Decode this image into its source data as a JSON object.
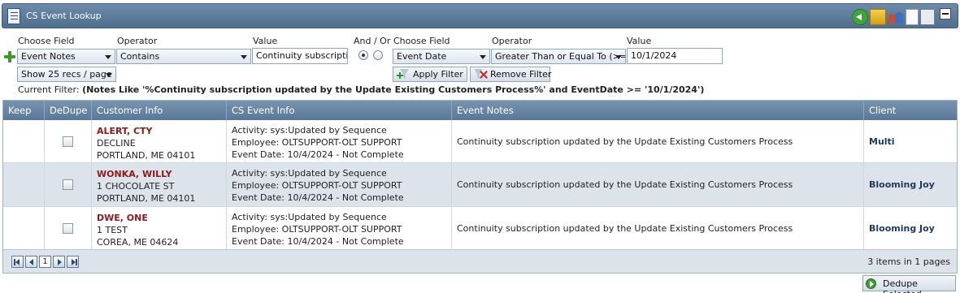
{
  "window": {
    "title": "CS Event Lookup",
    "toolbar_icons": [
      "back-icon",
      "box-icon",
      "users-icon",
      "document-icon",
      "files-icon",
      "minimize-icon"
    ]
  },
  "filter": {
    "left": {
      "choose_field_label": "Choose Field",
      "operator_label": "Operator",
      "value_label": "Value",
      "field": "Event Notes",
      "operator": "Contains",
      "value": "Continuity subscription"
    },
    "and_or_label": "And / Or",
    "and_or_selected": "And",
    "right": {
      "choose_field_label": "Choose Field",
      "operator_label": "Operator",
      "value_label": "Value",
      "field": "Event Date",
      "operator": "Greater Than or Equal To (>=)",
      "value": "10/1/2024"
    },
    "page_size": "Show 25 recs / page",
    "apply_label": "Apply Filter",
    "remove_label": "Remove Filter",
    "current_filter_label": "Current Filter:",
    "current_filter_value": "(Notes Like '%Continuity subscription updated by the Update Existing Customers Process%' and EventDate >= '10/1/2024')"
  },
  "grid": {
    "columns": [
      "Keep",
      "DeDupe",
      "Customer Info",
      "CS Event Info",
      "Event Notes",
      "Client"
    ],
    "rows": [
      {
        "name": "ALERT, CTY",
        "address1": "DECLINE",
        "address2": "PORTLAND, ME 04101",
        "activity": "Activity: sys:Updated by Sequence",
        "employee": "Employee: OLTSUPPORT-OLT SUPPORT",
        "event_date": "Event Date: 10/4/2024  - Not Complete",
        "notes": "Continuity subscription updated by the Update Existing Customers Process",
        "client": "Multi"
      },
      {
        "name": "WONKA, WILLY",
        "address1": "1 CHOCOLATE ST",
        "address2": "PORTLAND, ME 04101",
        "activity": "Activity: sys:Updated by Sequence",
        "employee": "Employee: OLTSUPPORT-OLT SUPPORT",
        "event_date": "Event Date: 10/4/2024  - Not Complete",
        "notes": "Continuity subscription updated by the Update Existing Customers Process",
        "client": "Blooming Joy"
      },
      {
        "name": "DWE, ONE",
        "address1": "1 TEST",
        "address2": "COREA, ME 04624",
        "activity": "Activity: sys:Updated by Sequence",
        "employee": "Employee: OLTSUPPORT-OLT SUPPORT",
        "event_date": "Event Date: 10/4/2024  - Not Complete",
        "notes": "Continuity subscription updated by the Update Existing Customers Process",
        "client": "Blooming Joy"
      }
    ]
  },
  "pager": {
    "current_page": "1",
    "items_count": "3",
    "items_text": " items in ",
    "pages_count": "1",
    "pages_text": " pages"
  },
  "dedupe_label": "Dedupe Selected",
  "colors": {
    "header_bg": "#59789a",
    "customer_name": "#8b1a1a",
    "client": "#1f3a5c",
    "alt_row": "#dde3ea"
  }
}
